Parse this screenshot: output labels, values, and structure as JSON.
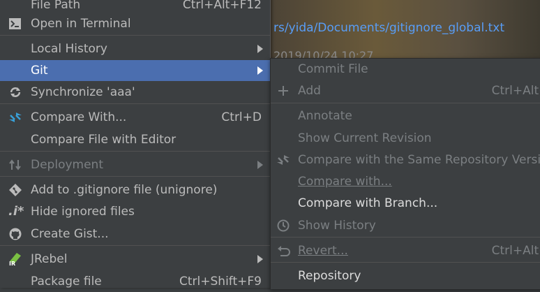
{
  "background": {
    "path": "rs/yida/Documents/gitignore_global.txt",
    "date": "2019/10/24 10:27"
  },
  "menu": {
    "file_path": {
      "label": "File Path",
      "shortcut": "Ctrl+Alt+F12"
    },
    "open_terminal": {
      "label": "Open in Terminal"
    },
    "local_history": {
      "label": "Local History"
    },
    "git": {
      "label": "Git"
    },
    "synchronize": {
      "label": "Synchronize 'aaa'"
    },
    "compare_with": {
      "label": "Compare With...",
      "shortcut": "Ctrl+D"
    },
    "compare_file_editor": {
      "label": "Compare File with Editor"
    },
    "deployment": {
      "label": "Deployment"
    },
    "add_gitignore": {
      "label": "Add to .gitignore file (unignore)"
    },
    "hide_ignored": {
      "label": "Hide ignored files"
    },
    "create_gist": {
      "label": "Create Gist..."
    },
    "jrebel": {
      "label": "JRebel"
    },
    "package_file": {
      "label": "Package file",
      "shortcut": "Ctrl+Shift+F9"
    }
  },
  "submenu": {
    "commit_file": {
      "label": "Commit File"
    },
    "add": {
      "label": "Add",
      "shortcut": "Ctrl+Alt+A"
    },
    "annotate": {
      "label": "Annotate"
    },
    "show_current_revision": {
      "label": "Show Current Revision"
    },
    "compare_same_repo": {
      "label": "Compare with the Same Repository Version"
    },
    "compare_with": {
      "label": "Compare with..."
    },
    "compare_branch": {
      "label": "Compare with Branch..."
    },
    "show_history": {
      "label": "Show History"
    },
    "revert": {
      "label": "Revert...",
      "shortcut": "Ctrl+Alt+Z"
    },
    "repository": {
      "label": "Repository"
    }
  },
  "colors": {
    "selection": "#4b6eaf",
    "menu_bg": "#3c3f41",
    "link": "#589df6"
  }
}
